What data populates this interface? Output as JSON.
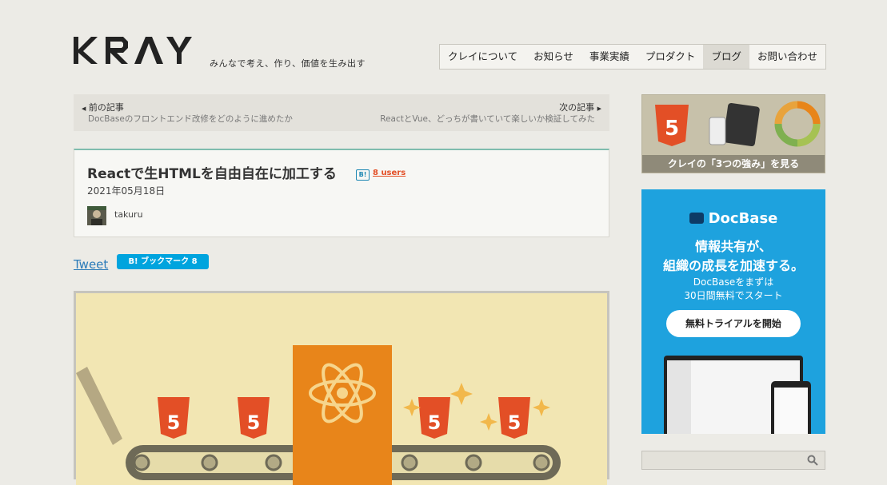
{
  "header": {
    "logo": "KRAY",
    "tagline": "みんなで考え、作り、価値を生み出す",
    "nav": [
      "クレイについて",
      "お知らせ",
      "事業実績",
      "プロダクト",
      "ブログ",
      "お問い合わせ"
    ],
    "active_nav": "ブログ"
  },
  "pager": {
    "prev_label": "前の記事",
    "prev_title": "DocBaseのフロントエンド改修をどのように進めたか",
    "next_label": "次の記事",
    "next_title": "ReactとVue、どっちが書いていて楽しいか検証してみた"
  },
  "article": {
    "title": "Reactで生HTMLを自由自在に加工する",
    "hatena_icon": "B!",
    "users": "8 users",
    "date": "2021年05月18日",
    "author": "takuru"
  },
  "share": {
    "tweet": "Tweet",
    "bookmark": "B! ブックマーク 8"
  },
  "sidebar": {
    "promo1_text": "クレイの「3つの強み」を見る",
    "promo2": {
      "brand": "DocBase",
      "headline_1": "情報共有が、",
      "headline_2": "組織の成長を加速する。",
      "sub_1": "DocBaseをまずは",
      "sub_2": "30日間無料でスタート",
      "cta": "無料トライアルを開始"
    },
    "search_placeholder": ""
  },
  "colors": {
    "background": "#ecebe6",
    "accent_teal": "#7fbcae",
    "html5_orange": "#e34f26",
    "docbase_blue": "#1ea2de",
    "bookmark_blue": "#00a4de"
  }
}
